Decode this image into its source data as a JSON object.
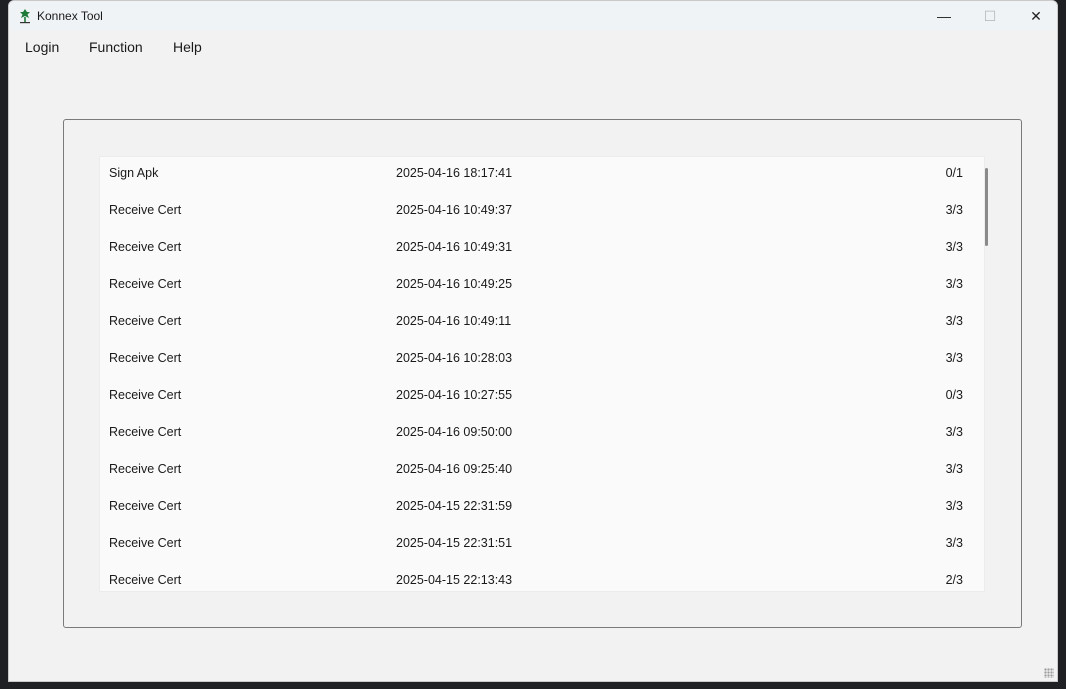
{
  "window": {
    "title": "Konnex Tool",
    "minimize_glyph": "—",
    "maximize_glyph": "☐",
    "close_glyph": "✕"
  },
  "menu": {
    "items": [
      {
        "label": "Login"
      },
      {
        "label": "Function"
      },
      {
        "label": "Help"
      }
    ]
  },
  "records": [
    {
      "name": "Sign Apk",
      "time": "2025-04-16 18:17:41",
      "count": "0/1"
    },
    {
      "name": "Receive Cert",
      "time": "2025-04-16 10:49:37",
      "count": "3/3"
    },
    {
      "name": "Receive Cert",
      "time": "2025-04-16 10:49:31",
      "count": "3/3"
    },
    {
      "name": "Receive Cert",
      "time": "2025-04-16 10:49:25",
      "count": "3/3"
    },
    {
      "name": "Receive Cert",
      "time": "2025-04-16 10:49:11",
      "count": "3/3"
    },
    {
      "name": "Receive Cert",
      "time": "2025-04-16 10:28:03",
      "count": "3/3"
    },
    {
      "name": "Receive Cert",
      "time": "2025-04-16 10:27:55",
      "count": "0/3"
    },
    {
      "name": "Receive Cert",
      "time": "2025-04-16 09:50:00",
      "count": "3/3"
    },
    {
      "name": "Receive Cert",
      "time": "2025-04-16 09:25:40",
      "count": "3/3"
    },
    {
      "name": "Receive Cert",
      "time": "2025-04-15 22:31:59",
      "count": "3/3"
    },
    {
      "name": "Receive Cert",
      "time": "2025-04-15 22:31:51",
      "count": "3/3"
    },
    {
      "name": "Receive Cert",
      "time": "2025-04-15 22:13:43",
      "count": "2/3"
    }
  ],
  "colors": {
    "window_bg": "#f2f2f2",
    "list_bg": "#fafafa",
    "icon_green": "#1f7a3a"
  },
  "icons": {
    "app": "konnex-logo-icon",
    "minimize": "minimize-icon",
    "maximize": "maximize-icon",
    "close": "close-icon"
  }
}
